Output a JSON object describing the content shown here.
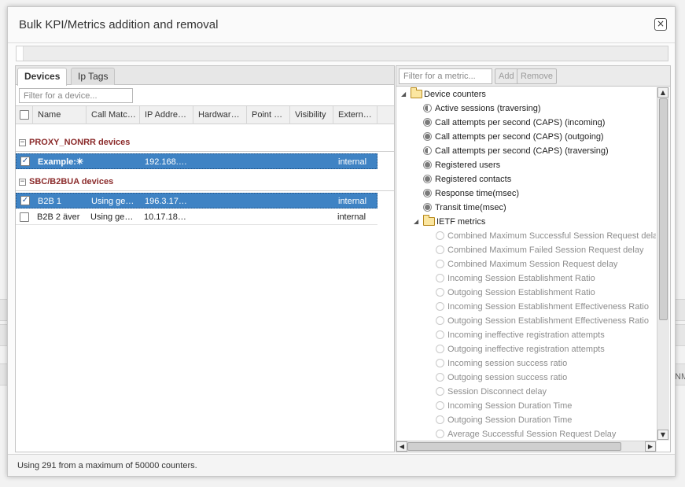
{
  "dialog": {
    "title": "Bulk KPI/Metrics addition and removal",
    "close_label": "×"
  },
  "background": {
    "edge_text": "NM"
  },
  "tabs": [
    {
      "label": "Devices",
      "active": true
    },
    {
      "label": "Ip Tags",
      "active": false
    }
  ],
  "device_filter": {
    "placeholder": "Filter for a device..."
  },
  "columns": [
    "Name",
    "Call Matc…",
    "IP Addre…",
    "Hardwar…",
    "Point …",
    "Visibility",
    "Extern…"
  ],
  "groups": [
    {
      "label": "PROXY_NONRR devices",
      "collapse_icon": "−",
      "rows": [
        {
          "checked": true,
          "selected": true,
          "name": "Example:✳",
          "call_match": "",
          "ip": "192.168.…",
          "hardware": "",
          "point": "",
          "visibility": "",
          "external": "internal"
        }
      ]
    },
    {
      "label": "SBC/B2BUA devices",
      "collapse_icon": "−",
      "rows": [
        {
          "checked": true,
          "selected": true,
          "name": "B2B 1",
          "call_match": "Using ge…",
          "ip": "196.3.17…",
          "hardware": "",
          "point": "",
          "visibility": "",
          "external": "internal"
        },
        {
          "checked": false,
          "selected": false,
          "name": "B2B 2 äver",
          "call_match": "Using ge…",
          "ip": "10.17.18…",
          "hardware": "",
          "point": "",
          "visibility": "",
          "external": "internal"
        }
      ]
    }
  ],
  "checkbox_mark": "✓",
  "footer": {
    "text": "Using 291 from a maximum of 50000 counters."
  },
  "metric_filter": {
    "placeholder": "Filter for a metric..."
  },
  "buttons": {
    "add": "Add",
    "remove": "Remove"
  },
  "tree": {
    "device_counters": {
      "label": "Device counters",
      "twisty": "◢",
      "items": [
        {
          "label": "Active sessions (traversing)",
          "state": "half"
        },
        {
          "label": "Call attempts per second (CAPS) (incoming)",
          "state": "full"
        },
        {
          "label": "Call attempts per second (CAPS) (outgoing)",
          "state": "full"
        },
        {
          "label": "Call attempts per second (CAPS) (traversing)",
          "state": "half"
        },
        {
          "label": "Registered users",
          "state": "full"
        },
        {
          "label": "Registered contacts",
          "state": "full"
        },
        {
          "label": "Response time(msec)",
          "state": "full"
        },
        {
          "label": "Transit time(msec)",
          "state": "full"
        }
      ]
    },
    "ietf_metrics": {
      "label": "IETF metrics",
      "twisty": "◢",
      "items": [
        {
          "label": "Combined Maximum Successful Session Request delay",
          "state": "empty"
        },
        {
          "label": "Combined Maximum Failed Session Request delay",
          "state": "empty"
        },
        {
          "label": "Combined Maximum Session Request delay",
          "state": "empty"
        },
        {
          "label": "Incoming Session Establishment Ratio",
          "state": "empty"
        },
        {
          "label": "Outgoing Session Establishment Ratio",
          "state": "empty"
        },
        {
          "label": "Incoming Session Establishment Effectiveness Ratio",
          "state": "empty"
        },
        {
          "label": "Outgoing Session Establishment Effectiveness Ratio",
          "state": "empty"
        },
        {
          "label": "Incoming ineffective registration attempts",
          "state": "empty"
        },
        {
          "label": "Outgoing ineffective registration attempts",
          "state": "empty"
        },
        {
          "label": "Incoming session success ratio",
          "state": "empty"
        },
        {
          "label": "Outgoing session success ratio",
          "state": "empty"
        },
        {
          "label": "Session Disconnect delay",
          "state": "empty"
        },
        {
          "label": "Incoming Session Duration Time",
          "state": "empty"
        },
        {
          "label": "Outgoing Session Duration Time",
          "state": "empty"
        },
        {
          "label": "Average Successful Session Request Delay",
          "state": "empty"
        }
      ]
    }
  },
  "scroll_arrows": {
    "up": "▲",
    "down": "▼",
    "left": "◀",
    "right": "▶"
  }
}
